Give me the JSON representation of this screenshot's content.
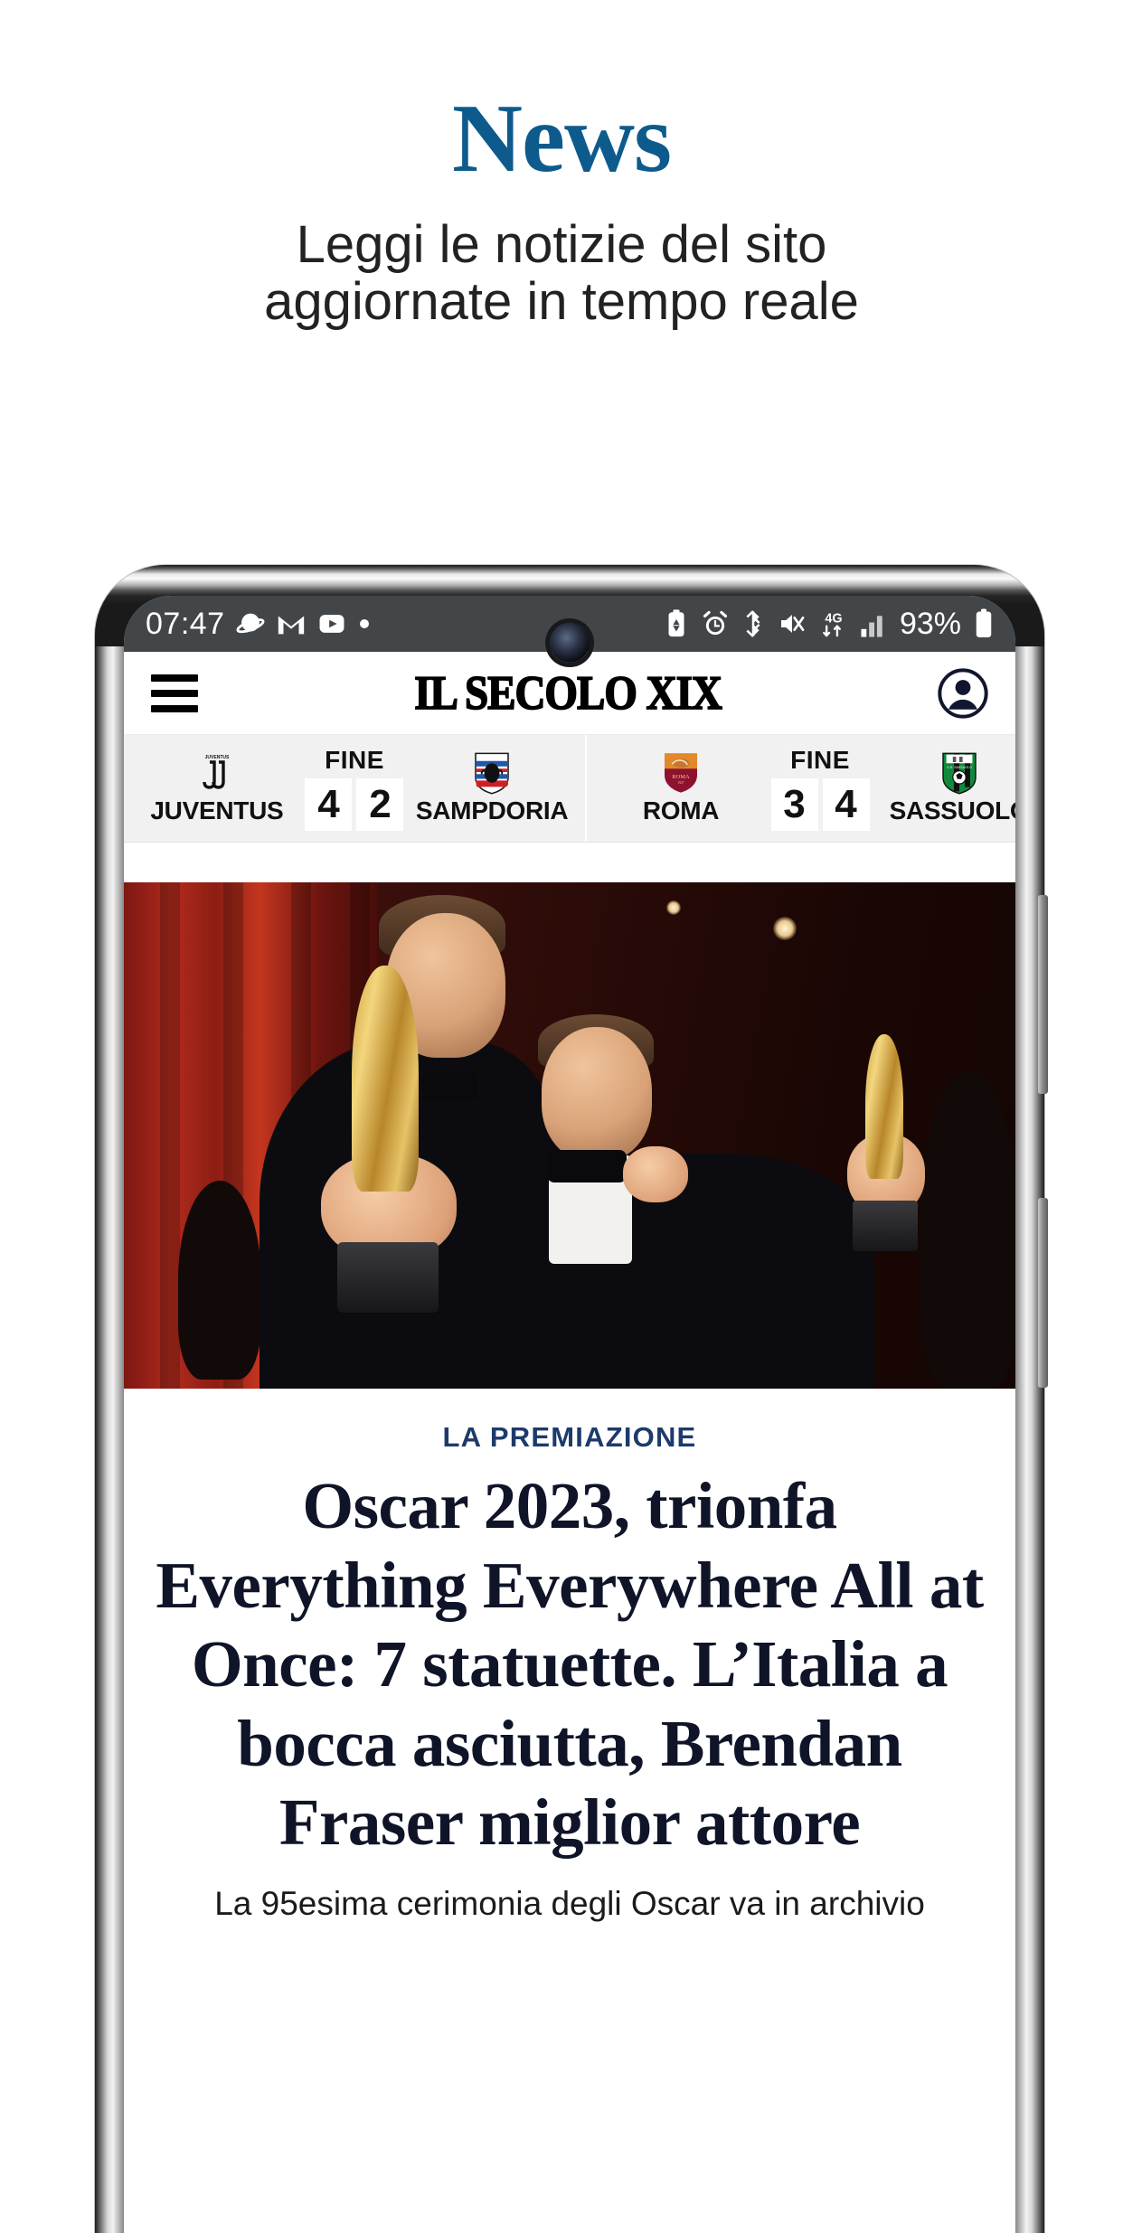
{
  "promo": {
    "title": "News",
    "subtitle_line1": "Leggi le notizie del sito",
    "subtitle_line2": "aggiornate in tempo reale",
    "title_color": "#0d5b8c"
  },
  "statusbar": {
    "time": "07:47",
    "left_icons": [
      "saturn-app-icon",
      "gmail-icon",
      "youtube-icon",
      "dot-indicator-icon"
    ],
    "right_icons": [
      "battery-saver-icon",
      "alarm-icon",
      "bluetooth-icon",
      "vibrate-mute-icon",
      "network-4g-icon",
      "signal-bars-icon"
    ],
    "battery_percent": "93%",
    "battery_icon": "battery-icon",
    "background": "#434649"
  },
  "app_header": {
    "menu_icon": "hamburger-menu-icon",
    "masthead": "IL SECOLO XIX",
    "account_icon": "account-circle-icon"
  },
  "scores": {
    "matches": [
      {
        "home_team": "JUVENTUS",
        "home_crest": "juventus-crest-icon",
        "away_team": "SAMPDORIA",
        "away_crest": "sampdoria-crest-icon",
        "status": "FINE",
        "home_score": "4",
        "away_score": "2"
      },
      {
        "home_team": "ROMA",
        "home_crest": "roma-crest-icon",
        "away_team": "SASSUOLO",
        "away_crest": "sassuolo-crest-icon",
        "status": "FINE",
        "home_score": "3",
        "away_score": "4"
      }
    ]
  },
  "article": {
    "photo_alt": "oscar-winners-photo",
    "kicker": "LA PREMIAZIONE",
    "headline": "Oscar 2023, trionfa Everything Everywhere All at Once: 7 statuette. L’Italia a bocca asciutta, Brendan Fraser miglior attore",
    "standfirst": "La 95esima cerimonia degli Oscar va in archivio",
    "kicker_color": "#1d3a6b",
    "headline_color": "#101428"
  }
}
